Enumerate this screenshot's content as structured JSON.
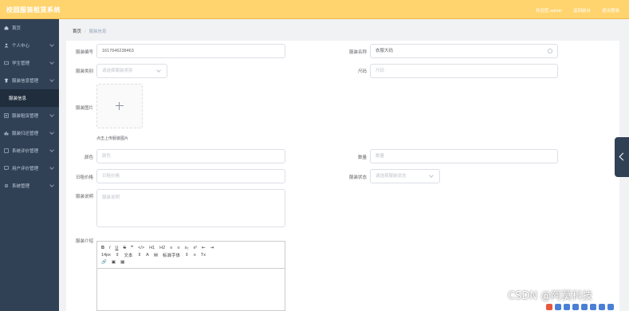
{
  "header": {
    "app_title": "校园服装租赁系统",
    "links": [
      "欢迎您 admin",
      "返回前台",
      "退出登录"
    ]
  },
  "sidebar": {
    "items": [
      {
        "label": "首页",
        "icon": "home-icon"
      },
      {
        "label": "个人中心",
        "icon": "user-icon"
      },
      {
        "label": "学生管理",
        "icon": "student-icon"
      },
      {
        "label": "服装信息管理",
        "icon": "shirt-icon"
      },
      {
        "label": "服装租赁管理",
        "icon": "list-icon"
      },
      {
        "label": "服装归还管理",
        "icon": "return-icon"
      },
      {
        "label": "系统评价管理",
        "icon": "star-icon"
      },
      {
        "label": "用户评价管理",
        "icon": "comment-icon"
      },
      {
        "label": "系统管理",
        "icon": "gear-icon"
      }
    ],
    "active_sub": "服装信息"
  },
  "breadcrumb": {
    "home": "首页",
    "separator": "/",
    "current": "服装信息"
  },
  "form": {
    "bianhao": {
      "label": "服装编号",
      "value": "1617646238463"
    },
    "mingcheng": {
      "label": "服装名称",
      "value": "衣服大码"
    },
    "leibie": {
      "label": "服装类别",
      "placeholder": "请选择服装类别"
    },
    "chima": {
      "label": "尺码",
      "placeholder": "尺码"
    },
    "tupian": {
      "label": "服装图片",
      "hint": "点击上传服装图片"
    },
    "yanse": {
      "label": "颜色",
      "placeholder": "颜色"
    },
    "shuliang": {
      "label": "数量",
      "placeholder": "数量"
    },
    "jiage": {
      "label": "日租价格",
      "placeholder": "日租价格"
    },
    "zhuangtai": {
      "label": "服装状态",
      "placeholder": "请选择服装状态"
    },
    "miaoshu": {
      "label": "服装说明",
      "placeholder": "服装说明"
    },
    "jieshao": {
      "label": "服装介绍"
    }
  },
  "editor": {
    "row1": [
      "B",
      "I",
      "U",
      "S",
      "❞",
      "</>",
      "H1",
      "H2",
      "≡",
      "≡",
      "x₂",
      "x²",
      "⇤",
      "⇥"
    ],
    "row2": [
      "14px",
      "⇕",
      "文本",
      "⇕",
      "A",
      "▤",
      "标准字体",
      "⇕",
      "≡",
      "Tx"
    ],
    "row3": [
      "🔗",
      "▣",
      "▦"
    ]
  },
  "watermark": "CSDN @阿莫科技"
}
